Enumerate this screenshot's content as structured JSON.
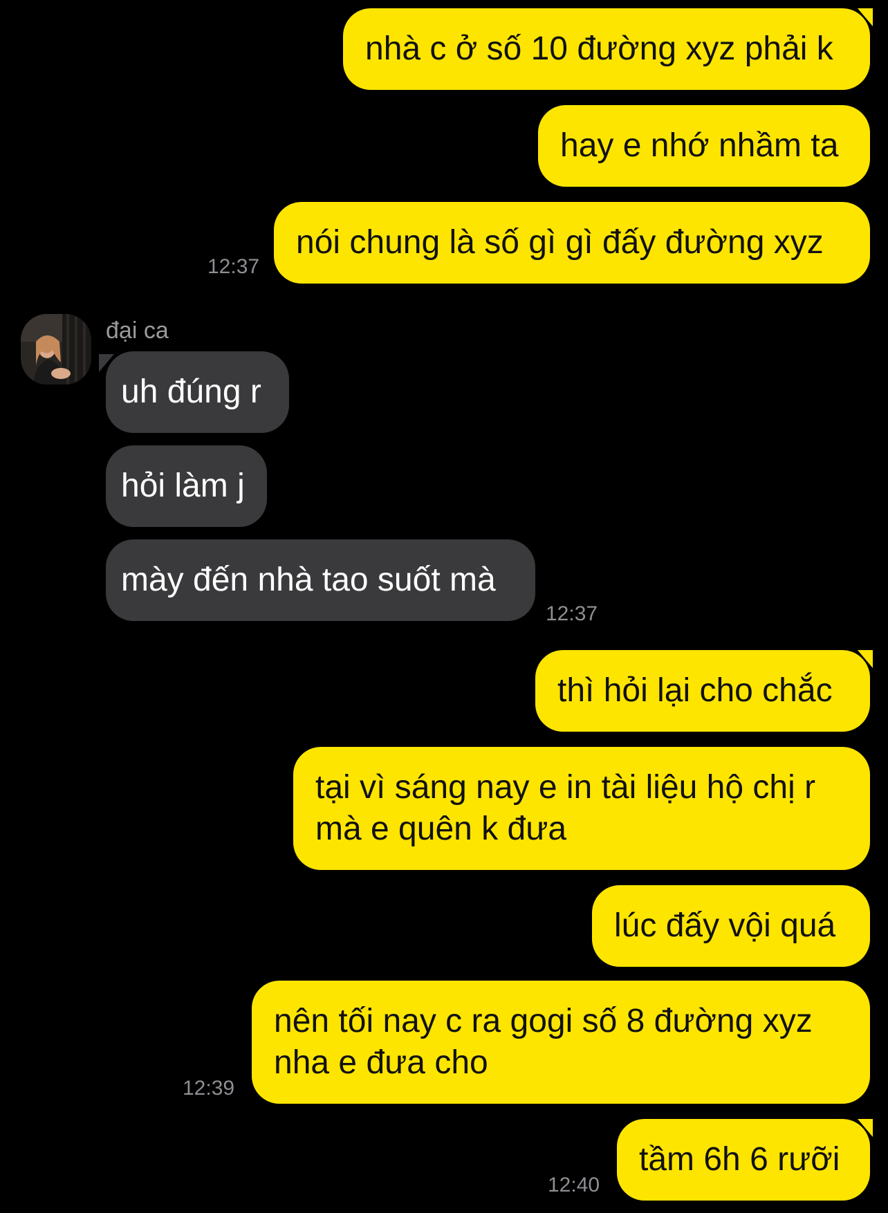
{
  "colors": {
    "background": "#000000",
    "outgoing_bubble": "#FEE500",
    "incoming_bubble": "#3A3A3C",
    "timestamp": "#8E8E93"
  },
  "contact": {
    "name": "đại ca",
    "avatar_icon": "profile-photo"
  },
  "messages": [
    {
      "id": "m1",
      "direction": "outgoing",
      "text": "nhà c ở số 10 đường xyz phải k"
    },
    {
      "id": "m2",
      "direction": "outgoing",
      "text": "hay e nhớ nhầm ta"
    },
    {
      "id": "m3",
      "direction": "outgoing",
      "text": "nói chung là số gì gì đấy đường xyz",
      "time": "12:37"
    },
    {
      "id": "m4",
      "direction": "incoming",
      "text": "uh đúng r"
    },
    {
      "id": "m5",
      "direction": "incoming",
      "text": "hỏi làm j"
    },
    {
      "id": "m6",
      "direction": "incoming",
      "text": "mày đến nhà tao suốt mà",
      "time": "12:37"
    },
    {
      "id": "m7",
      "direction": "outgoing",
      "text": "thì hỏi lại cho chắc"
    },
    {
      "id": "m8",
      "direction": "outgoing",
      "text": "tại vì sáng nay e in tài liệu hộ chị r\nmà e quên k đưa"
    },
    {
      "id": "m9",
      "direction": "outgoing",
      "text": "lúc đấy vội quá"
    },
    {
      "id": "m10",
      "direction": "outgoing",
      "text": "nên tối nay c ra gogi số 8 đường xyz\nnha e đưa cho",
      "time": "12:39"
    },
    {
      "id": "m11",
      "direction": "outgoing",
      "text": "tầm 6h 6 rưỡi",
      "time": "12:40"
    }
  ]
}
